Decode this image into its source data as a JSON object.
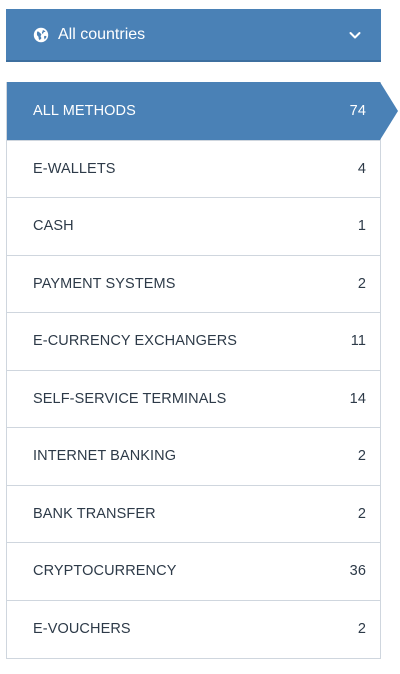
{
  "country_filter": {
    "label": "All countries",
    "icon": "globe-icon",
    "dropdown_icon": "chevron-down-icon"
  },
  "methods": [
    {
      "label": "ALL METHODS",
      "count": "74",
      "active": true
    },
    {
      "label": "E-WALLETS",
      "count": "4"
    },
    {
      "label": "CASH",
      "count": "1"
    },
    {
      "label": "PAYMENT SYSTEMS",
      "count": "2"
    },
    {
      "label": "E-CURRENCY EXCHANGERS",
      "count": "11"
    },
    {
      "label": "SELF-SERVICE TERMINALS",
      "count": "14"
    },
    {
      "label": "INTERNET BANKING",
      "count": "2"
    },
    {
      "label": "BANK TRANSFER",
      "count": "2"
    },
    {
      "label": "CRYPTOCURRENCY",
      "count": "36"
    },
    {
      "label": "E-VOUCHERS",
      "count": "2"
    }
  ],
  "colors": {
    "accent": "#4a81b6",
    "text": "#2d3a48",
    "border": "#cfd6de"
  }
}
